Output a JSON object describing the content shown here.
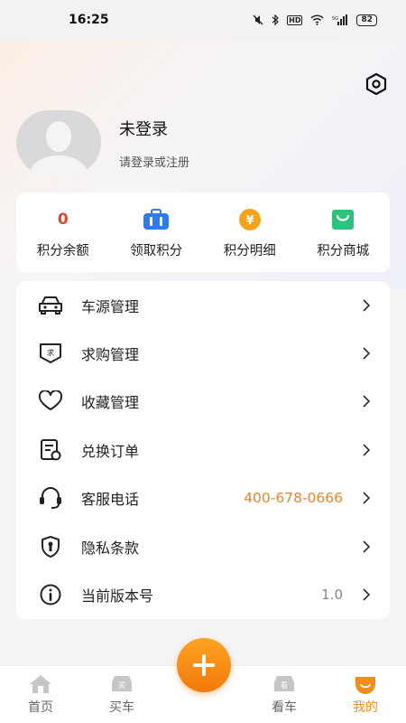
{
  "status_bar": {
    "time": "16:25",
    "battery": "82"
  },
  "header": {
    "settings_icon": "hexagon-gear-icon"
  },
  "profile": {
    "name": "未登录",
    "subtitle": "请登录或注册"
  },
  "points": [
    {
      "value": "0",
      "label": "积分余额",
      "icon": "number"
    },
    {
      "label": "领取积分",
      "icon": "briefcase-icon",
      "color": "#2f7be8"
    },
    {
      "label": "积分明细",
      "icon": "yen-coin-icon",
      "color": "#f5a21d"
    },
    {
      "label": "积分商城",
      "icon": "shopping-bag-icon",
      "color": "#2ec27e"
    }
  ],
  "menu": [
    {
      "label": "车源管理",
      "icon": "car-icon",
      "value": ""
    },
    {
      "label": "求购管理",
      "icon": "wanted-badge-icon",
      "value": ""
    },
    {
      "label": "收藏管理",
      "icon": "heart-icon",
      "value": ""
    },
    {
      "label": "兑换订单",
      "icon": "order-document-icon",
      "value": ""
    },
    {
      "label": "客服电话",
      "icon": "headset-icon",
      "value": "400-678-0666"
    },
    {
      "label": "隐私条款",
      "icon": "shield-icon",
      "value": ""
    },
    {
      "label": "当前版本号",
      "icon": "info-icon",
      "value": "1.0"
    }
  ],
  "tabbar": {
    "tabs": [
      {
        "label": "首页",
        "icon": "home-icon"
      },
      {
        "label": "买车",
        "icon": "buy-car-icon"
      },
      {
        "label": "看车",
        "icon": "view-car-icon"
      },
      {
        "label": "我的",
        "icon": "profile-icon"
      }
    ],
    "active": "我的",
    "accent": "#f28c1a"
  }
}
